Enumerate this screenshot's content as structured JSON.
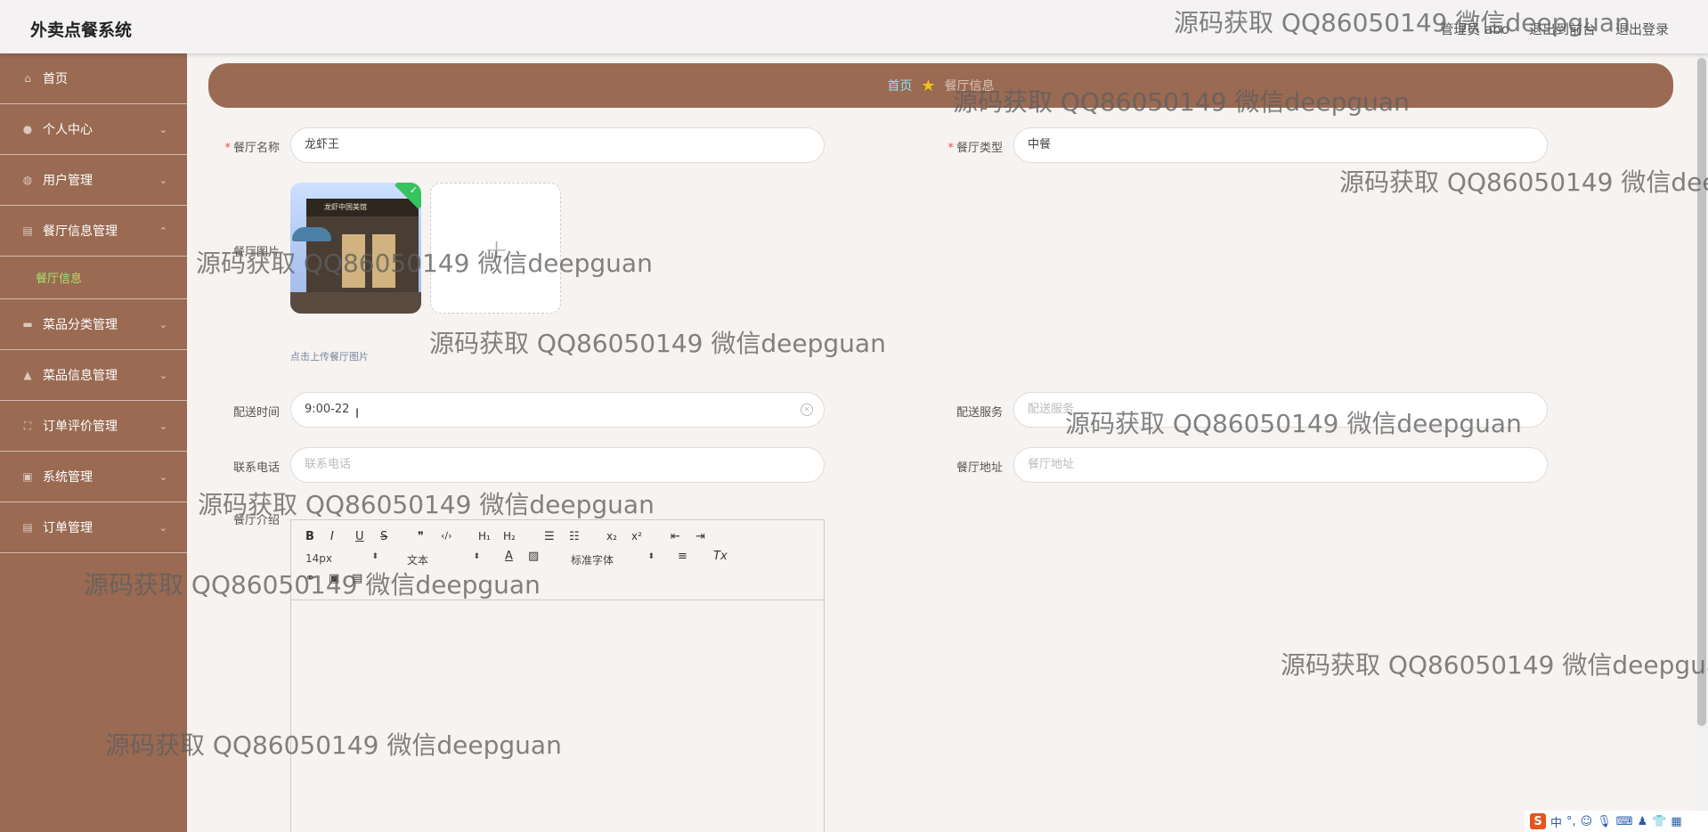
{
  "header": {
    "app_title": "外卖点餐系统",
    "user_label": "管理员 abo",
    "back_to_front": "退出到前台",
    "logout": "退出登录"
  },
  "sidebar": {
    "items": [
      {
        "label": "首页",
        "icon": "home-icon"
      },
      {
        "label": "个人中心",
        "icon": "user-icon"
      },
      {
        "label": "用户管理",
        "icon": "users-icon"
      },
      {
        "label": "餐厅信息管理",
        "icon": "clipboard-icon"
      },
      {
        "label": "菜品分类管理",
        "icon": "chat-icon"
      },
      {
        "label": "菜品信息管理",
        "icon": "thumb-icon"
      },
      {
        "label": "订单评价管理",
        "icon": "frame-icon"
      },
      {
        "label": "系统管理",
        "icon": "settings-icon"
      },
      {
        "label": "订单管理",
        "icon": "clipboard-icon"
      }
    ],
    "sub_active": "餐厅信息"
  },
  "breadcrumb": {
    "home": "首页",
    "current": "餐厅信息"
  },
  "form": {
    "name_label": "餐厅名称",
    "name_value": "龙虾王",
    "type_label": "餐厅类型",
    "type_value": "中餐",
    "image_label": "餐厅图片",
    "upload_hint": "点击上传餐厅图片",
    "photo_sign_text": "龙虾中国美馆",
    "delivery_time_label": "配送时间",
    "delivery_time_value": "9:00-22",
    "delivery_service_label": "配送服务",
    "delivery_service_placeholder": "配送服务",
    "phone_label": "联系电话",
    "phone_placeholder": "联系电话",
    "address_label": "餐厅地址",
    "address_placeholder": "餐厅地址",
    "intro_label": "餐厅介绍"
  },
  "editor": {
    "font_size": "14px",
    "format": "文本",
    "font_family": "标准字体",
    "buttons": {
      "bold": "B",
      "italic": "I",
      "underline": "U",
      "strike": "S",
      "quote": "❞",
      "code": "‹/›",
      "h1": "H₁",
      "h2": "H₂",
      "subscript": "x₂",
      "superscript": "x²",
      "font_color": "A",
      "clear_format": "Tx"
    }
  },
  "watermark": "源码获取 QQ86050149 微信deepguan",
  "ime": {
    "lang": "中",
    "punct": "°,"
  }
}
